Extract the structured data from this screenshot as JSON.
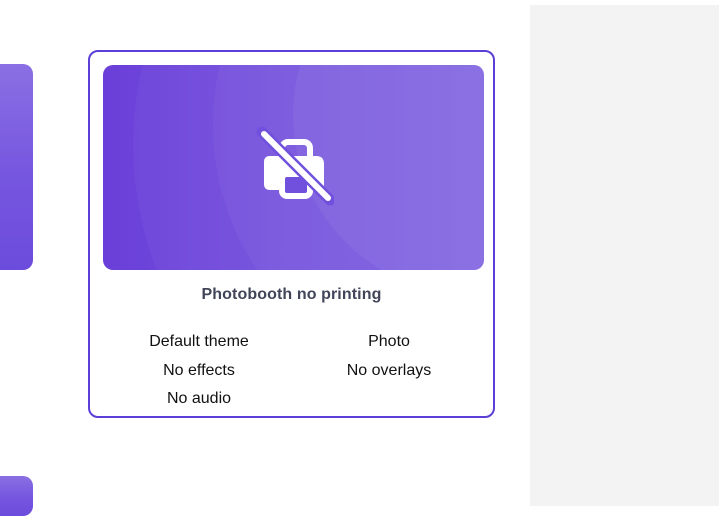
{
  "card": {
    "title": "Photobooth no printing",
    "preview_icon": "printer-off-icon",
    "features": {
      "theme": "Default theme",
      "mode": "Photo",
      "effects": "No effects",
      "overlays": "No overlays",
      "audio": "No audio"
    }
  },
  "colors": {
    "accent": "#5b3fd6",
    "preview_gradient_start": "#6a3fd9",
    "preview_gradient_end": "#7b5fe0",
    "title_text": "#414559",
    "panel_background": "#f3f3f3"
  }
}
